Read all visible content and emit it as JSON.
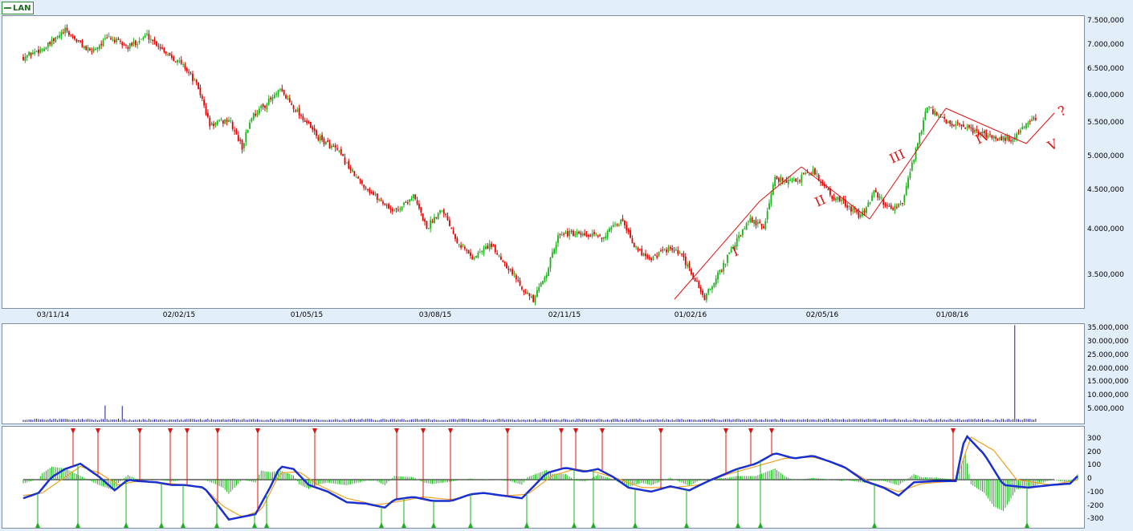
{
  "legend": {
    "label": "LAN"
  },
  "colors": {
    "up": "#19b219",
    "down": "#e00000",
    "volume": "#1a1a9c",
    "macd": "#1a2fd0",
    "signal": "#f0a020",
    "annotation": "#e01010",
    "background": "#e3eefb"
  },
  "chart_data": [
    {
      "type": "candlestick",
      "title": "",
      "xlabel": "",
      "ylabel": "",
      "x_tick_labels": [
        "03/11/14",
        "02/02/15",
        "01/05/15",
        "03/08/15",
        "02/11/15",
        "01/02/16",
        "02/05/16",
        "01/08/16"
      ],
      "y_tick_labels": [
        "7.500,000",
        "7.000,000",
        "6.500,000",
        "6.000,000",
        "5.500,000",
        "5.000,000",
        "4.500,000",
        "4.000,000",
        "3.500,000"
      ],
      "ylim": [
        3250,
        7550
      ],
      "close_path": [
        [
          0,
          6750
        ],
        [
          12,
          6950
        ],
        [
          22,
          7300
        ],
        [
          35,
          6850
        ],
        [
          45,
          7150
        ],
        [
          55,
          6950
        ],
        [
          65,
          7200
        ],
        [
          75,
          6850
        ],
        [
          85,
          6550
        ],
        [
          92,
          6150
        ],
        [
          98,
          5500
        ],
        [
          108,
          5600
        ],
        [
          115,
          5150
        ],
        [
          120,
          5650
        ],
        [
          127,
          5850
        ],
        [
          135,
          6100
        ],
        [
          145,
          5700
        ],
        [
          155,
          5300
        ],
        [
          165,
          5100
        ],
        [
          175,
          4700
        ],
        [
          185,
          4450
        ],
        [
          195,
          4250
        ],
        [
          205,
          4450
        ],
        [
          212,
          4050
        ],
        [
          220,
          4300
        ],
        [
          228,
          3900
        ],
        [
          236,
          3700
        ],
        [
          245,
          3850
        ],
        [
          253,
          3650
        ],
        [
          262,
          3400
        ],
        [
          268,
          3250
        ],
        [
          275,
          3550
        ],
        [
          282,
          4000
        ],
        [
          295,
          3950
        ],
        [
          305,
          3950
        ],
        [
          315,
          4150
        ],
        [
          322,
          3800
        ],
        [
          330,
          3700
        ],
        [
          338,
          3800
        ],
        [
          345,
          3750
        ],
        [
          352,
          3500
        ],
        [
          358,
          3280
        ],
        [
          366,
          3550
        ],
        [
          375,
          3900
        ],
        [
          382,
          4150
        ],
        [
          389,
          4050
        ],
        [
          395,
          4700
        ],
        [
          405,
          4650
        ],
        [
          415,
          4800
        ],
        [
          425,
          4450
        ],
        [
          432,
          4350
        ],
        [
          440,
          4180
        ],
        [
          447,
          4500
        ],
        [
          455,
          4300
        ],
        [
          462,
          4350
        ],
        [
          468,
          5000
        ],
        [
          475,
          5800
        ],
        [
          485,
          5550
        ],
        [
          495,
          5450
        ],
        [
          505,
          5350
        ],
        [
          512,
          5300
        ],
        [
          520,
          5280
        ],
        [
          527,
          5500
        ],
        [
          532,
          5600
        ]
      ],
      "annotations": [
        "I",
        "II",
        "III",
        "IV",
        "V",
        "?"
      ]
    },
    {
      "type": "bar",
      "title": "",
      "y_tick_labels": [
        "35.000,000",
        "30.000,000",
        "25.000,000",
        "20.000,000",
        "15.000,000",
        "10.000,000",
        "5.000,000"
      ],
      "ylim": [
        0,
        36000
      ],
      "typical_volume": 600,
      "spikes": [
        {
          "x": 43,
          "value": 5800
        },
        {
          "x": 52,
          "value": 5600
        },
        {
          "x": 521,
          "value": 35500
        }
      ]
    },
    {
      "type": "line",
      "title": "",
      "y_tick_labels": [
        "300",
        "200",
        "100",
        "0",
        "-100",
        "-200",
        "-300"
      ],
      "ylim": [
        -340,
        380
      ],
      "series": [
        {
          "role": "macd",
          "points": [
            [
              0,
              -140
            ],
            [
              8,
              -100
            ],
            [
              15,
              20
            ],
            [
              22,
              80
            ],
            [
              30,
              120
            ],
            [
              40,
              20
            ],
            [
              48,
              -80
            ],
            [
              55,
              0
            ],
            [
              60,
              -10
            ],
            [
              70,
              -20
            ],
            [
              78,
              -40
            ],
            [
              85,
              -40
            ],
            [
              95,
              -60
            ],
            [
              100,
              -150
            ],
            [
              108,
              -300
            ],
            [
              115,
              -280
            ],
            [
              122,
              -260
            ],
            [
              130,
              -50
            ],
            [
              135,
              100
            ],
            [
              142,
              80
            ],
            [
              150,
              -40
            ],
            [
              160,
              -90
            ],
            [
              170,
              -170
            ],
            [
              180,
              -180
            ],
            [
              190,
              -210
            ],
            [
              195,
              -150
            ],
            [
              205,
              -130
            ],
            [
              215,
              -160
            ],
            [
              225,
              -160
            ],
            [
              235,
              -110
            ],
            [
              242,
              -100
            ],
            [
              252,
              -120
            ],
            [
              262,
              -140
            ],
            [
              275,
              50
            ],
            [
              285,
              90
            ],
            [
              295,
              60
            ],
            [
              302,
              80
            ],
            [
              310,
              20
            ],
            [
              318,
              -60
            ],
            [
              330,
              -90
            ],
            [
              340,
              -50
            ],
            [
              350,
              -80
            ],
            [
              360,
              -10
            ],
            [
              375,
              80
            ],
            [
              385,
              120
            ],
            [
              395,
              200
            ],
            [
              405,
              160
            ],
            [
              415,
              180
            ],
            [
              425,
              130
            ],
            [
              432,
              90
            ],
            [
              442,
              -10
            ],
            [
              452,
              -60
            ],
            [
              460,
              -120
            ],
            [
              468,
              -20
            ],
            [
              480,
              -10
            ],
            [
              490,
              -10
            ],
            [
              495,
              340
            ],
            [
              505,
              190
            ],
            [
              515,
              -40
            ],
            [
              528,
              -60
            ],
            [
              540,
              -40
            ],
            [
              550,
              -30
            ],
            [
              555,
              40
            ]
          ]
        },
        {
          "role": "signal",
          "points": [
            [
              0,
              -120
            ],
            [
              10,
              -100
            ],
            [
              20,
              0
            ],
            [
              30,
              100
            ],
            [
              40,
              50
            ],
            [
              50,
              -40
            ],
            [
              60,
              -10
            ],
            [
              70,
              -20
            ],
            [
              85,
              -40
            ],
            [
              95,
              -60
            ],
            [
              105,
              -200
            ],
            [
              115,
              -280
            ],
            [
              125,
              -230
            ],
            [
              135,
              50
            ],
            [
              145,
              60
            ],
            [
              155,
              -40
            ],
            [
              170,
              -140
            ],
            [
              185,
              -190
            ],
            [
              195,
              -170
            ],
            [
              210,
              -130
            ],
            [
              225,
              -150
            ],
            [
              240,
              -100
            ],
            [
              255,
              -120
            ],
            [
              265,
              -110
            ],
            [
              278,
              30
            ],
            [
              290,
              80
            ],
            [
              300,
              60
            ],
            [
              312,
              10
            ],
            [
              325,
              -60
            ],
            [
              340,
              -60
            ],
            [
              355,
              -40
            ],
            [
              370,
              40
            ],
            [
              385,
              100
            ],
            [
              400,
              160
            ],
            [
              415,
              170
            ],
            [
              430,
              110
            ],
            [
              445,
              -20
            ],
            [
              460,
              -90
            ],
            [
              472,
              -30
            ],
            [
              490,
              -10
            ],
            [
              498,
              320
            ],
            [
              510,
              220
            ],
            [
              522,
              0
            ],
            [
              540,
              -40
            ],
            [
              555,
              0
            ]
          ]
        }
      ],
      "buy_signals": 18,
      "sell_signals": 22
    }
  ]
}
